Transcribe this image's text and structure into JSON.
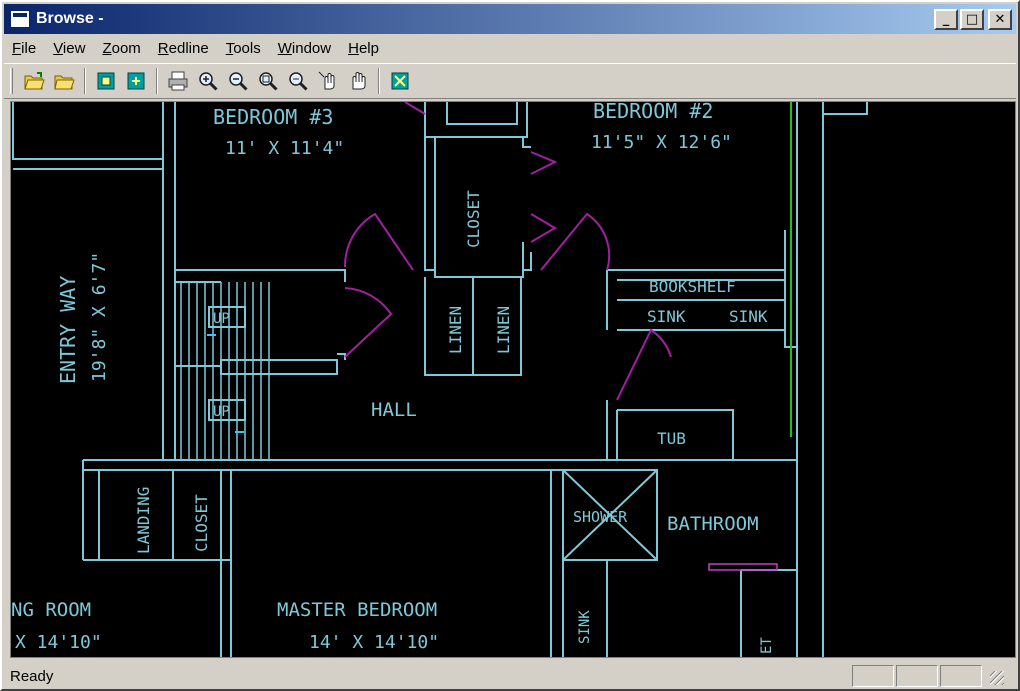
{
  "window": {
    "title": "Browse -"
  },
  "window_buttons": {
    "minimize": "_",
    "maximize": "□",
    "close": "✕"
  },
  "menu": [
    "File",
    "View",
    "Zoom",
    "Redline",
    "Tools",
    "Window",
    "Help"
  ],
  "toolbar": {
    "buttons": [
      {
        "icon": "open-folder-icon"
      },
      {
        "icon": "folder-icon"
      },
      {
        "icon": "layer-icon"
      },
      {
        "icon": "layer-alt-icon"
      },
      {
        "icon": "print-icon"
      },
      {
        "icon": "zoom-in-icon"
      },
      {
        "icon": "zoom-out-icon"
      },
      {
        "icon": "zoom-window-icon"
      },
      {
        "icon": "zoom-extents-icon"
      },
      {
        "icon": "select-hand-icon"
      },
      {
        "icon": "pan-hand-icon"
      },
      {
        "icon": "fit-view-icon"
      }
    ]
  },
  "floorplan": {
    "colors": {
      "walls": "#7fc8d8",
      "doors": "#a020a0",
      "background": "#000000",
      "accent": "#20c020"
    },
    "labels": {
      "bedroom3": "BEDROOM #3",
      "bedroom3_size": "11' X 11'4\"",
      "bedroom2": "BEDROOM #2",
      "bedroom2_size": "11'5\" X 12'6\"",
      "entry": "ENTRY WAY",
      "entry_size": "19'8\" X 6'7\"",
      "closet_top": "CLOSET",
      "linen1": "LINEN",
      "linen2": "LINEN",
      "bookshelf": "BOOKSHELF",
      "sink1": "SINK",
      "sink2": "SINK",
      "up1": "UP",
      "up2": "UP",
      "hall": "HALL",
      "tub": "TUB",
      "landing": "LANDING",
      "closet_bottom": "CLOSET",
      "shower": "SHOWER",
      "bathroom": "BATHROOM",
      "living_room": "NG ROOM",
      "living_size": "X 14'10\"",
      "master": "MASTER BEDROOM",
      "master_size": "14' X 14'10\"",
      "sink3": "SINK",
      "et": "ET"
    }
  },
  "status": {
    "text": "Ready"
  }
}
